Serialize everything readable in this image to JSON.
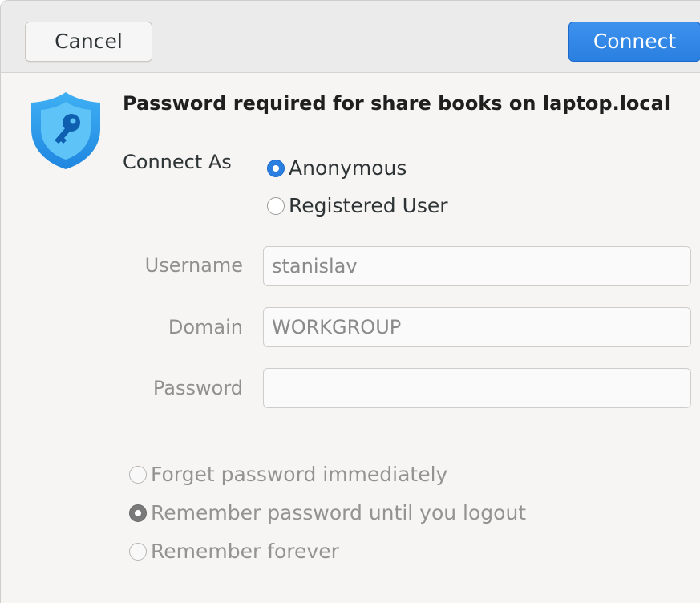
{
  "header": {
    "cancel_label": "Cancel",
    "connect_label": "Connect"
  },
  "prompt": {
    "icon": "shield-key-icon",
    "title": "Password required for share books on laptop.local"
  },
  "connect_as": {
    "label": "Connect As",
    "options": [
      {
        "label": "Anonymous",
        "selected": true
      },
      {
        "label": "Registered User",
        "selected": false
      }
    ]
  },
  "fields": {
    "username": {
      "label": "Username",
      "value": "stanislav"
    },
    "domain": {
      "label": "Domain",
      "value": "WORKGROUP"
    },
    "password": {
      "label": "Password",
      "value": ""
    }
  },
  "remember": {
    "options": [
      {
        "label": "Forget password immediately",
        "selected": false
      },
      {
        "label": "Remember password until you logout",
        "selected": true
      },
      {
        "label": "Remember forever",
        "selected": false
      }
    ]
  },
  "colors": {
    "accent": "#2a7fe0",
    "shield_top": "#39a6f0",
    "shield_bottom": "#1f86e0"
  }
}
